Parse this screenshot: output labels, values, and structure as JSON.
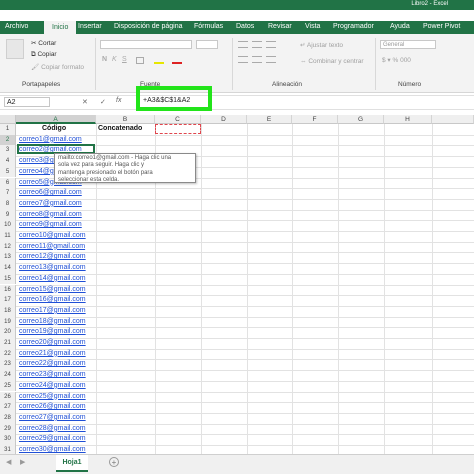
{
  "title_bar": {
    "title": "Libro2 - Excel"
  },
  "ribbon_tabs": [
    "Archivo",
    "Inicio",
    "Insertar",
    "Disposición de página",
    "Fórmulas",
    "Datos",
    "Revisar",
    "Vista",
    "Programador",
    "Ayuda",
    "Power Pivot"
  ],
  "active_tab": "Inicio",
  "clipboard": {
    "cut": "Cortar",
    "copy": "Copiar",
    "format_painter": "Copiar formato",
    "group": "Portapapeles"
  },
  "font": {
    "group": "Fuente"
  },
  "alignment": {
    "wrap": "Ajustar texto",
    "merge": "Combinar y centrar",
    "group": "Alineación"
  },
  "number": {
    "format": "General",
    "group": "Número"
  },
  "formula_bar": {
    "name_box": "A2",
    "formula": "+A3&$C$1&A2",
    "cancel": "✕",
    "enter": "✓",
    "fx": "fx"
  },
  "columns": [
    "A",
    "B",
    "C",
    "D",
    "E",
    "F",
    "G",
    "H"
  ],
  "rows": [
    "1",
    "2",
    "3",
    "4",
    "5",
    "6",
    "7",
    "8",
    "9",
    "10",
    "11",
    "12",
    "13",
    "14",
    "15",
    "16",
    "17",
    "18",
    "19",
    "20",
    "21",
    "22",
    "23",
    "24",
    "25",
    "26",
    "27",
    "28",
    "29",
    "30",
    "31"
  ],
  "cells": {
    "a1": "Código",
    "b1": "Concatenado",
    "column_a": [
      "correo1@gmail.com",
      "correo2@gmail.com",
      "correo3@gmail.com",
      "correo4@gmail.com",
      "correo5@gmail.com",
      "correo6@gmail.com",
      "correo7@gmail.com",
      "correo8@gmail.com",
      "correo9@gmail.com",
      "correo10@gmail.com",
      "correo11@gmail.com",
      "correo12@gmail.com",
      "correo13@gmail.com",
      "correo14@gmail.com",
      "correo15@gmail.com",
      "correo16@gmail.com",
      "correo17@gmail.com",
      "correo18@gmail.com",
      "correo19@gmail.com",
      "correo20@gmail.com",
      "correo21@gmail.com",
      "correo22@gmail.com",
      "correo23@gmail.com",
      "correo24@gmail.com",
      "correo25@gmail.com",
      "correo26@gmail.com",
      "correo27@gmail.com",
      "correo28@gmail.com",
      "correo29@gmail.com",
      "correo30@gmail.com"
    ]
  },
  "tooltip": {
    "line1": "mailto:correo1@gmail.com - Haga clic una",
    "line2": "sola vez para seguir. Haga clic y",
    "line3": "mantenga presionado el botón para",
    "line4": "seleccionar esta celda."
  },
  "sheet_tab": {
    "name": "Hoja1",
    "add": "+"
  },
  "colors": {
    "excel_green": "#217346",
    "highlight": "#22e41a",
    "link": "#1f4fd6"
  }
}
